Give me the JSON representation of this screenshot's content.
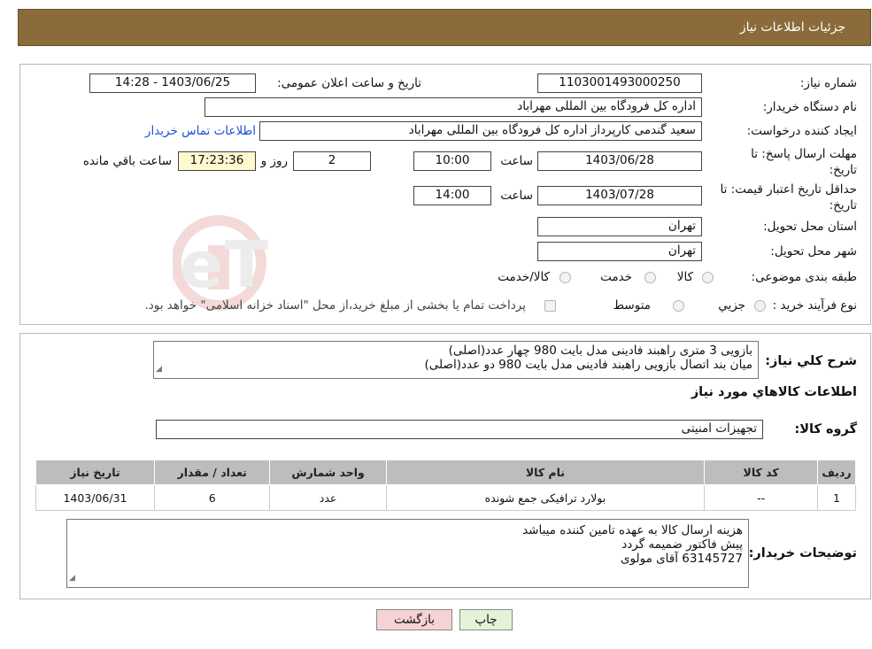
{
  "header": {
    "title": "جزئیات اطلاعات نیاز"
  },
  "form": {
    "need_number_label": "شماره نیاز:",
    "need_number": "1103001493000250",
    "announce_label": "تاریخ و ساعت اعلان عمومی:",
    "announce_value": "1403/06/25 - 14:28",
    "buyer_org_label": "نام دستگاه خریدار:",
    "buyer_org": "اداره کل فرودگاه بین المللی مهراباد",
    "creator_label": "ایجاد کننده درخواست:",
    "creator": "سعید گندمی کارپرداز اداره کل فرودگاه بین المللی مهراباد",
    "contact_link": "اطلاعات تماس خریدار",
    "reply_deadline_label": "مهلت ارسال پاسخ: تا تاریخ:",
    "reply_date": "1403/06/28",
    "time_label": "ساعت",
    "reply_time": "10:00",
    "days_value": "2",
    "days_label": "روز و",
    "remaining_time": "17:23:36",
    "remaining_label": "ساعت باقي مانده",
    "price_validity_label": "حداقل تاریخ اعتبار قیمت: تا تاریخ:",
    "price_date": "1403/07/28",
    "price_time": "14:00",
    "province_label": "استان محل تحویل:",
    "province": "تهران",
    "city_label": "شهر محل تحویل:",
    "city": "تهران",
    "category_label": "طبقه بندی موضوعی:",
    "category_options": [
      "کالا",
      "خدمت",
      "کالا/خدمت"
    ],
    "process_label": "نوع فرآیند خرید :",
    "process_options": [
      "جزیي",
      "متوسط"
    ],
    "payment_note": "پرداخت تمام یا بخشی از مبلغ خرید،از محل \"اسناد خزانه اسلامی\" خواهد بود."
  },
  "watermark": {
    "text": "AriaTender.neT"
  },
  "description": {
    "label": "شرح کلي نياز:",
    "lines": [
      "بازویی 3 متری راهبند فادینی مدل بایت 980 چهار عدد(اصلی)",
      "میان بند اتصال بازویی راهبند فادینی مدل بایت 980 دو عدد(اصلی)"
    ]
  },
  "goods": {
    "title": "اطلاعات کالاهاي مورد نياز",
    "group_label": "گروه کالا:",
    "group_value": "تجهیزات امنیتی",
    "table": {
      "headers": [
        "رديف",
        "کد کالا",
        "نام کالا",
        "واحد شمارش",
        "تعداد / مقدار",
        "تاریخ نیاز"
      ],
      "rows": [
        [
          "1",
          "--",
          "بولارد ترافیکی جمع شونده",
          "عدد",
          "6",
          "1403/06/31"
        ]
      ]
    }
  },
  "buyer_notes": {
    "label": "توضیحات خریدار:",
    "lines": [
      "هزینه ارسال کالا به عهده تامین کننده میباشد",
      "پیش فاکتور ضمیمه گردد",
      "63145727 آقای مولوی"
    ]
  },
  "buttons": {
    "print": "چاپ",
    "back": "بازگشت"
  },
  "colors": {
    "header": "#8b6b3a",
    "yellow_box": "#fff9cf",
    "link": "#1a4fd6",
    "back_button": "#f7d2d2",
    "print_button": "#e3f3d8"
  }
}
